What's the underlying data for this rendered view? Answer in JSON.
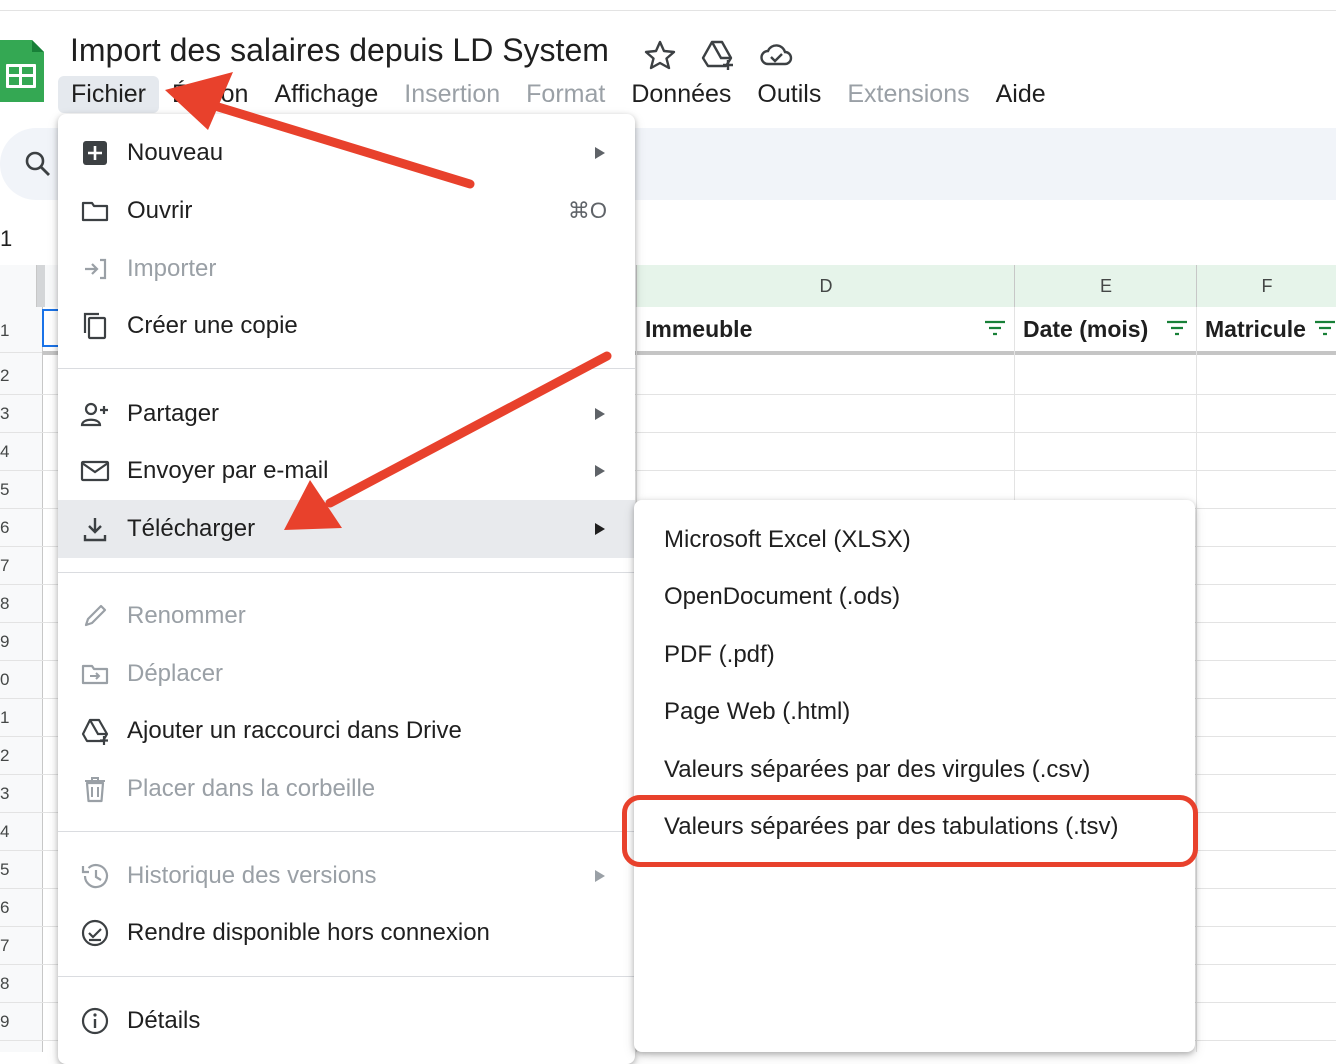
{
  "doc": {
    "title": "Import des salaires depuis LD System",
    "title_icons": [
      "star-icon",
      "move-to-drive-icon",
      "cloud-status-icon"
    ]
  },
  "menubar": {
    "items": [
      "Fichier",
      "Édition",
      "Affichage",
      "Insertion",
      "Format",
      "Données",
      "Outils",
      "Extensions",
      "Aide"
    ],
    "active": "Fichier"
  },
  "namebox": {
    "value": "1"
  },
  "grid": {
    "columns": [
      "D",
      "E",
      "F"
    ],
    "headers": [
      "Immeuble",
      "Date (mois)",
      "Matricule"
    ],
    "row_numbers": [
      "1",
      "2",
      "3",
      "4",
      "5",
      "6",
      "7",
      "8",
      "9",
      "0",
      "1",
      "2",
      "3",
      "4",
      "5",
      "6",
      "7",
      "8",
      "9"
    ]
  },
  "file_menu": {
    "items": [
      {
        "label": "Nouveau",
        "icon": "new-sheet-icon",
        "submenu": true,
        "disabled": false
      },
      {
        "label": "Ouvrir",
        "icon": "folder-icon",
        "shortcut": "⌘O",
        "disabled": false
      },
      {
        "label": "Importer",
        "icon": "import-icon",
        "disabled": true
      },
      {
        "label": "Créer une copie",
        "icon": "copy-icon",
        "disabled": false
      },
      {
        "label": "Partager",
        "icon": "add-person-icon",
        "submenu": true,
        "disabled": false
      },
      {
        "label": "Envoyer par e-mail",
        "icon": "mail-icon",
        "submenu": true,
        "disabled": false
      },
      {
        "label": "Télécharger",
        "icon": "download-icon",
        "submenu": true,
        "disabled": false,
        "highlighted": true
      },
      {
        "label": "Renommer",
        "icon": "pencil-icon",
        "disabled": true
      },
      {
        "label": "Déplacer",
        "icon": "move-folder-icon",
        "disabled": true
      },
      {
        "label": "Ajouter un raccourci dans Drive",
        "icon": "drive-shortcut-icon",
        "disabled": false
      },
      {
        "label": "Placer dans la corbeille",
        "icon": "trash-icon",
        "disabled": true
      },
      {
        "label": "Historique des versions",
        "icon": "history-icon",
        "submenu": true,
        "disabled": true
      },
      {
        "label": "Rendre disponible hors connexion",
        "icon": "offline-check-icon",
        "disabled": false
      },
      {
        "label": "Détails",
        "icon": "info-icon",
        "disabled": false
      }
    ]
  },
  "download_submenu": {
    "items": [
      "Microsoft Excel (XLSX)",
      "OpenDocument (.ods)",
      "PDF (.pdf)",
      "Page Web (.html)",
      "Valeurs séparées par des virgules (.csv)",
      "Valeurs séparées par des tabulations (.tsv)"
    ],
    "emphasized": "Valeurs séparées par des tabulations (.tsv)"
  },
  "colors": {
    "annotation_red": "#e8412c",
    "sheets_green": "#34a853",
    "selected_column_header": "#e6f4ea",
    "menu_highlight": "#e8eaed",
    "disabled_text": "#9aa0a6"
  }
}
